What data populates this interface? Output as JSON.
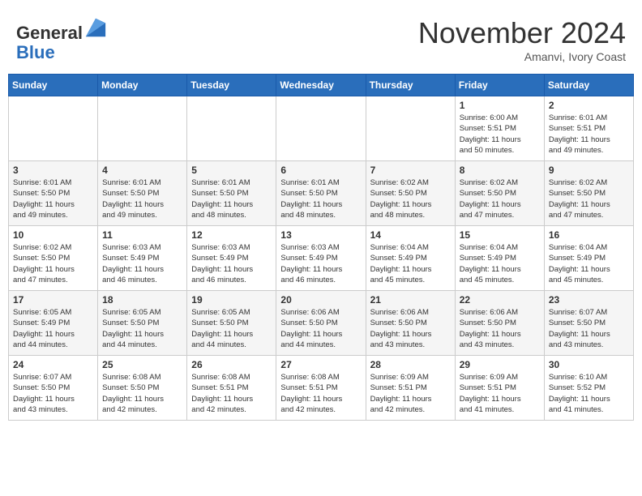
{
  "logo": {
    "general": "General",
    "blue": "Blue"
  },
  "header": {
    "month": "November 2024",
    "location": "Amanvi, Ivory Coast"
  },
  "weekdays": [
    "Sunday",
    "Monday",
    "Tuesday",
    "Wednesday",
    "Thursday",
    "Friday",
    "Saturday"
  ],
  "weeks": [
    [
      {
        "day": "",
        "info": ""
      },
      {
        "day": "",
        "info": ""
      },
      {
        "day": "",
        "info": ""
      },
      {
        "day": "",
        "info": ""
      },
      {
        "day": "",
        "info": ""
      },
      {
        "day": "1",
        "info": "Sunrise: 6:00 AM\nSunset: 5:51 PM\nDaylight: 11 hours\nand 50 minutes."
      },
      {
        "day": "2",
        "info": "Sunrise: 6:01 AM\nSunset: 5:51 PM\nDaylight: 11 hours\nand 49 minutes."
      }
    ],
    [
      {
        "day": "3",
        "info": "Sunrise: 6:01 AM\nSunset: 5:50 PM\nDaylight: 11 hours\nand 49 minutes."
      },
      {
        "day": "4",
        "info": "Sunrise: 6:01 AM\nSunset: 5:50 PM\nDaylight: 11 hours\nand 49 minutes."
      },
      {
        "day": "5",
        "info": "Sunrise: 6:01 AM\nSunset: 5:50 PM\nDaylight: 11 hours\nand 48 minutes."
      },
      {
        "day": "6",
        "info": "Sunrise: 6:01 AM\nSunset: 5:50 PM\nDaylight: 11 hours\nand 48 minutes."
      },
      {
        "day": "7",
        "info": "Sunrise: 6:02 AM\nSunset: 5:50 PM\nDaylight: 11 hours\nand 48 minutes."
      },
      {
        "day": "8",
        "info": "Sunrise: 6:02 AM\nSunset: 5:50 PM\nDaylight: 11 hours\nand 47 minutes."
      },
      {
        "day": "9",
        "info": "Sunrise: 6:02 AM\nSunset: 5:50 PM\nDaylight: 11 hours\nand 47 minutes."
      }
    ],
    [
      {
        "day": "10",
        "info": "Sunrise: 6:02 AM\nSunset: 5:50 PM\nDaylight: 11 hours\nand 47 minutes."
      },
      {
        "day": "11",
        "info": "Sunrise: 6:03 AM\nSunset: 5:49 PM\nDaylight: 11 hours\nand 46 minutes."
      },
      {
        "day": "12",
        "info": "Sunrise: 6:03 AM\nSunset: 5:49 PM\nDaylight: 11 hours\nand 46 minutes."
      },
      {
        "day": "13",
        "info": "Sunrise: 6:03 AM\nSunset: 5:49 PM\nDaylight: 11 hours\nand 46 minutes."
      },
      {
        "day": "14",
        "info": "Sunrise: 6:04 AM\nSunset: 5:49 PM\nDaylight: 11 hours\nand 45 minutes."
      },
      {
        "day": "15",
        "info": "Sunrise: 6:04 AM\nSunset: 5:49 PM\nDaylight: 11 hours\nand 45 minutes."
      },
      {
        "day": "16",
        "info": "Sunrise: 6:04 AM\nSunset: 5:49 PM\nDaylight: 11 hours\nand 45 minutes."
      }
    ],
    [
      {
        "day": "17",
        "info": "Sunrise: 6:05 AM\nSunset: 5:49 PM\nDaylight: 11 hours\nand 44 minutes."
      },
      {
        "day": "18",
        "info": "Sunrise: 6:05 AM\nSunset: 5:50 PM\nDaylight: 11 hours\nand 44 minutes."
      },
      {
        "day": "19",
        "info": "Sunrise: 6:05 AM\nSunset: 5:50 PM\nDaylight: 11 hours\nand 44 minutes."
      },
      {
        "day": "20",
        "info": "Sunrise: 6:06 AM\nSunset: 5:50 PM\nDaylight: 11 hours\nand 44 minutes."
      },
      {
        "day": "21",
        "info": "Sunrise: 6:06 AM\nSunset: 5:50 PM\nDaylight: 11 hours\nand 43 minutes."
      },
      {
        "day": "22",
        "info": "Sunrise: 6:06 AM\nSunset: 5:50 PM\nDaylight: 11 hours\nand 43 minutes."
      },
      {
        "day": "23",
        "info": "Sunrise: 6:07 AM\nSunset: 5:50 PM\nDaylight: 11 hours\nand 43 minutes."
      }
    ],
    [
      {
        "day": "24",
        "info": "Sunrise: 6:07 AM\nSunset: 5:50 PM\nDaylight: 11 hours\nand 43 minutes."
      },
      {
        "day": "25",
        "info": "Sunrise: 6:08 AM\nSunset: 5:50 PM\nDaylight: 11 hours\nand 42 minutes."
      },
      {
        "day": "26",
        "info": "Sunrise: 6:08 AM\nSunset: 5:51 PM\nDaylight: 11 hours\nand 42 minutes."
      },
      {
        "day": "27",
        "info": "Sunrise: 6:08 AM\nSunset: 5:51 PM\nDaylight: 11 hours\nand 42 minutes."
      },
      {
        "day": "28",
        "info": "Sunrise: 6:09 AM\nSunset: 5:51 PM\nDaylight: 11 hours\nand 42 minutes."
      },
      {
        "day": "29",
        "info": "Sunrise: 6:09 AM\nSunset: 5:51 PM\nDaylight: 11 hours\nand 41 minutes."
      },
      {
        "day": "30",
        "info": "Sunrise: 6:10 AM\nSunset: 5:52 PM\nDaylight: 11 hours\nand 41 minutes."
      }
    ]
  ]
}
